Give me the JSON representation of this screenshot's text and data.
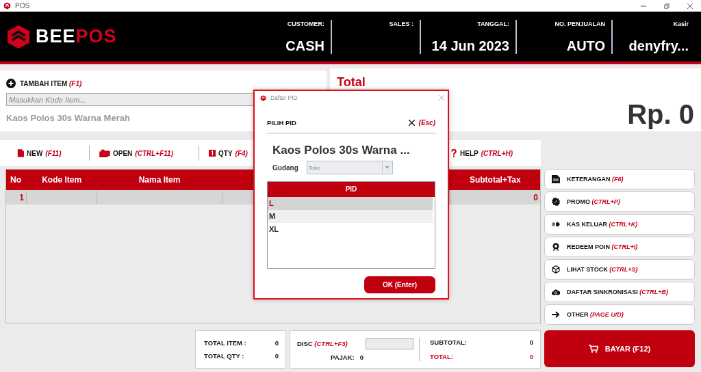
{
  "window": {
    "title": "POS"
  },
  "header": {
    "brand": {
      "part_1": "BEE",
      "part_2": "POS"
    },
    "fields": [
      {
        "label": "CUSTOMER:",
        "value": "CASH"
      },
      {
        "label": "SALES :"
      },
      {
        "label": "TANGGAL:",
        "value": "14 Jun 2023"
      },
      {
        "label": "NO. PENJUALAN",
        "value": "AUTO"
      },
      {
        "label": "Kasir",
        "value": "denyfry..."
      }
    ]
  },
  "add_item": {
    "label": "TAMBAH ITEM",
    "shortcut": "(F1)",
    "placeholder": "Masukkan Kode Item...",
    "last_item": "Kaos Polos 30s Warna Merah"
  },
  "total": {
    "label": "Total",
    "value": "Rp. 0"
  },
  "toolbar": [
    {
      "kind": "new",
      "label": "NEW",
      "shortcut": "(F11)"
    },
    {
      "kind": "open",
      "label": "OPEN",
      "shortcut": "(CTRL+F11)"
    },
    {
      "kind": "qty",
      "label": "QTY",
      "shortcut": "(F4)"
    },
    {
      "kind": "help",
      "label": "HELP",
      "shortcut": "(CTRL+H)"
    }
  ],
  "table": {
    "columns": [
      "No",
      "Kode Item",
      "Nama Item",
      "Subtotal+Tax"
    ],
    "rows": [
      {
        "no": "1",
        "subtotal_tax": "0"
      }
    ]
  },
  "actions": [
    {
      "kind": "note",
      "label": "KETERANGAN",
      "shortcut": "(F6)"
    },
    {
      "kind": "promo",
      "label": "PROMO",
      "shortcut": "(CTRL+P)"
    },
    {
      "kind": "cash-out",
      "label": "KAS KELUAR",
      "shortcut": "(CTRL+K)"
    },
    {
      "kind": "award",
      "label": "REDEEM POIN",
      "shortcut": "(CTRL+I)"
    },
    {
      "kind": "box",
      "label": "LIHAT STOCK",
      "shortcut": "(CTRL+S)"
    },
    {
      "kind": "cloud",
      "label": "DAFTAR SINKRONISASI",
      "shortcut": "(CTRL+B)"
    },
    {
      "kind": "arrow",
      "label": "OTHER",
      "shortcut": "(PAGE U/D)"
    }
  ],
  "summary": {
    "total_item_label": "TOTAL ITEM :",
    "total_item": "0",
    "total_qty_label": "TOTAL QTY :",
    "total_qty": "0",
    "disc_label": "DISC",
    "disc_shortcut": "(CTRL+F3)",
    "tax_label": "PAJAK:",
    "tax": "0",
    "subtotal_label": "SUBTOTAL:",
    "subtotal": "0",
    "total_label": "TOTAL:",
    "total": "0"
  },
  "pay_button": {
    "label": "BAYAR (F12)"
  },
  "dialog": {
    "title": "Daftar PID",
    "heading": "PILIH PID",
    "close_shortcut": "(Esc)",
    "product": "Kaos Polos 30s Warna ...",
    "warehouse_label": "Gudang",
    "warehouse": {
      "value": "Toko",
      "disabled": true
    },
    "column": "PID",
    "items": [
      {
        "label": "L",
        "selected": true
      },
      {
        "label": "M",
        "selected": false
      },
      {
        "label": "XL",
        "selected": false
      }
    ],
    "ok_button": "OK (Enter)"
  }
}
